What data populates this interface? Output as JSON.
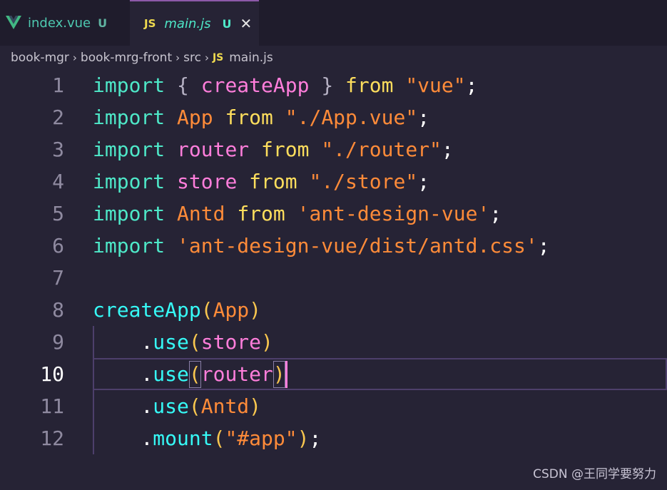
{
  "tabs": [
    {
      "label": "index.vue",
      "badge": "U",
      "icon": "vue-logo-icon"
    },
    {
      "label": "main.js",
      "badge": "U",
      "icon": "js-file-icon",
      "icon_text": "JS",
      "close": "✕"
    }
  ],
  "breadcrumb": {
    "items": [
      "book-mgr",
      "book-mrg-front",
      "src",
      "main.js"
    ],
    "separator": "›",
    "file_icon_text": "JS"
  },
  "editor": {
    "active_line": 10,
    "lines": [
      {
        "num": "1",
        "tokens": [
          [
            "kw",
            "import"
          ],
          [
            "punc",
            " "
          ],
          [
            "brace",
            "{"
          ],
          [
            "punc",
            " "
          ],
          [
            "id",
            "createApp"
          ],
          [
            "punc",
            " "
          ],
          [
            "brace",
            "}"
          ],
          [
            "punc",
            " "
          ],
          [
            "from",
            "from"
          ],
          [
            "punc",
            " "
          ],
          [
            "str",
            "\"vue\""
          ],
          [
            "punc",
            ";"
          ]
        ]
      },
      {
        "num": "2",
        "tokens": [
          [
            "kw",
            "import"
          ],
          [
            "punc",
            " "
          ],
          [
            "str",
            "App"
          ],
          [
            "punc",
            " "
          ],
          [
            "from",
            "from"
          ],
          [
            "punc",
            " "
          ],
          [
            "str",
            "\"./App.vue\""
          ],
          [
            "punc",
            ";"
          ]
        ]
      },
      {
        "num": "3",
        "tokens": [
          [
            "kw",
            "import"
          ],
          [
            "punc",
            " "
          ],
          [
            "id",
            "router"
          ],
          [
            "punc",
            " "
          ],
          [
            "from",
            "from"
          ],
          [
            "punc",
            " "
          ],
          [
            "str",
            "\"./router\""
          ],
          [
            "punc",
            ";"
          ]
        ]
      },
      {
        "num": "4",
        "tokens": [
          [
            "kw",
            "import"
          ],
          [
            "punc",
            " "
          ],
          [
            "id",
            "store"
          ],
          [
            "punc",
            " "
          ],
          [
            "from",
            "from"
          ],
          [
            "punc",
            " "
          ],
          [
            "str",
            "\"./store\""
          ],
          [
            "punc",
            ";"
          ]
        ]
      },
      {
        "num": "5",
        "tokens": [
          [
            "kw",
            "import"
          ],
          [
            "punc",
            " "
          ],
          [
            "str",
            "Antd"
          ],
          [
            "punc",
            " "
          ],
          [
            "from",
            "from"
          ],
          [
            "punc",
            " "
          ],
          [
            "str",
            "'ant-design-vue'"
          ],
          [
            "punc",
            ";"
          ]
        ]
      },
      {
        "num": "6",
        "tokens": [
          [
            "kw",
            "import"
          ],
          [
            "punc",
            " "
          ],
          [
            "str",
            "'ant-design-vue/dist/antd.css'"
          ],
          [
            "punc",
            ";"
          ]
        ]
      },
      {
        "num": "7",
        "tokens": []
      },
      {
        "num": "8",
        "tokens": [
          [
            "fn",
            "createApp"
          ],
          [
            "paren",
            "("
          ],
          [
            "str",
            "App"
          ],
          [
            "paren",
            ")"
          ]
        ]
      },
      {
        "num": "9",
        "tokens": [
          [
            "punc",
            "    "
          ],
          [
            "dot",
            "."
          ],
          [
            "fn",
            "use"
          ],
          [
            "paren",
            "("
          ],
          [
            "id",
            "store"
          ],
          [
            "paren",
            ")"
          ]
        ]
      },
      {
        "num": "10",
        "tokens": [
          [
            "punc",
            "    "
          ],
          [
            "dot",
            "."
          ],
          [
            "fn",
            "use"
          ],
          [
            "paren",
            "("
          ],
          [
            "id",
            "router"
          ],
          [
            "paren",
            ")"
          ]
        ]
      },
      {
        "num": "11",
        "tokens": [
          [
            "punc",
            "    "
          ],
          [
            "dot",
            "."
          ],
          [
            "fn",
            "use"
          ],
          [
            "paren",
            "("
          ],
          [
            "str",
            "Antd"
          ],
          [
            "paren",
            ")"
          ]
        ]
      },
      {
        "num": "12",
        "tokens": [
          [
            "punc",
            "    "
          ],
          [
            "dot",
            "."
          ],
          [
            "fn",
            "mount"
          ],
          [
            "paren",
            "("
          ],
          [
            "str",
            "\"#app\""
          ],
          [
            "paren",
            ")"
          ],
          [
            "punc",
            ";"
          ]
        ]
      }
    ]
  },
  "watermark": "CSDN @王同学要努力",
  "colors": {
    "background": "#262335",
    "tabbar": "#1f1c2c",
    "keyword": "#4ee8c8",
    "identifier": "#ff7edb",
    "function": "#36f9f6",
    "from": "#fede5d",
    "string": "#ff8b39",
    "paren": "#f9c74f"
  }
}
